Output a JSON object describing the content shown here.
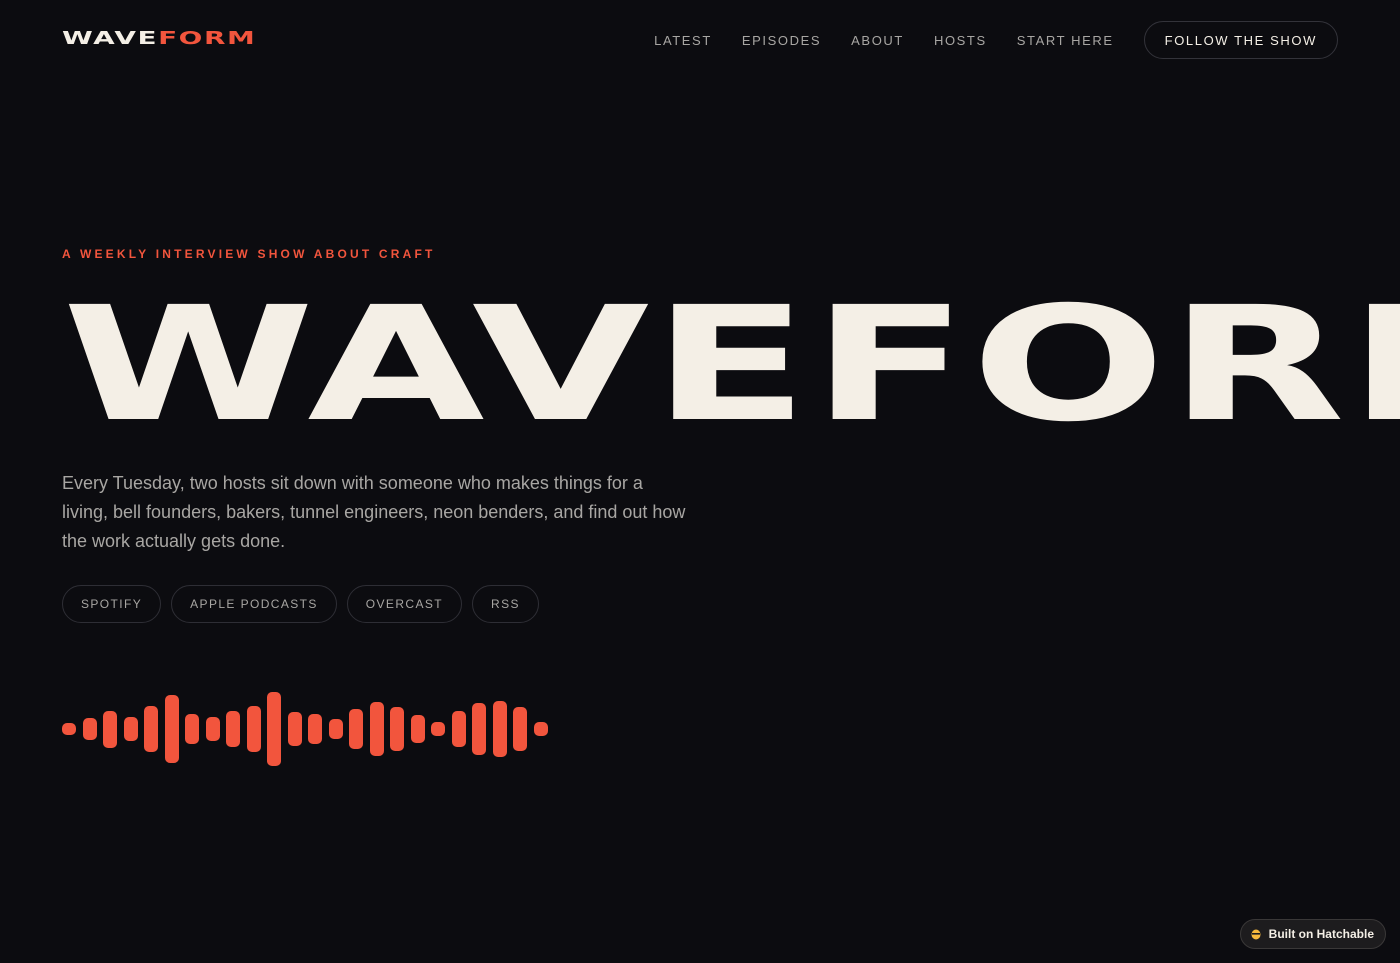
{
  "header": {
    "logo_part_a": "WAVE",
    "logo_part_b": "FORM",
    "nav": [
      {
        "label": "LATEST"
      },
      {
        "label": "EPISODES"
      },
      {
        "label": "ABOUT"
      },
      {
        "label": "HOSTS"
      },
      {
        "label": "START HERE"
      }
    ],
    "cta_label": "FOLLOW THE SHOW"
  },
  "hero": {
    "eyebrow": "A WEEKLY INTERVIEW SHOW ABOUT CRAFT",
    "title": "WAVEFORM",
    "intro": "Every Tuesday, two hosts sit down with someone who makes things for a living, bell founders, bakers, tunnel engineers, neon benders, and find out how the work actually gets done.",
    "platforms": [
      {
        "label": "SPOTIFY"
      },
      {
        "label": "APPLE PODCASTS"
      },
      {
        "label": "OVERCAST"
      },
      {
        "label": "RSS"
      }
    ]
  },
  "waveform": {
    "levels": [
      0.15,
      0.3,
      0.5,
      0.33,
      0.62,
      0.92,
      0.4,
      0.33,
      0.48,
      0.62,
      1.0,
      0.46,
      0.4,
      0.26,
      0.55,
      0.74,
      0.6,
      0.37,
      0.18,
      0.48,
      0.7,
      0.76,
      0.6,
      0.18
    ]
  },
  "badge": {
    "label": "Built on Hatchable",
    "icon": "hatchable-logo-icon"
  },
  "colors": {
    "background": "#0c0c10",
    "text": "#f4efe6",
    "accent": "#f2553d",
    "muted": "#a8a6a3"
  }
}
